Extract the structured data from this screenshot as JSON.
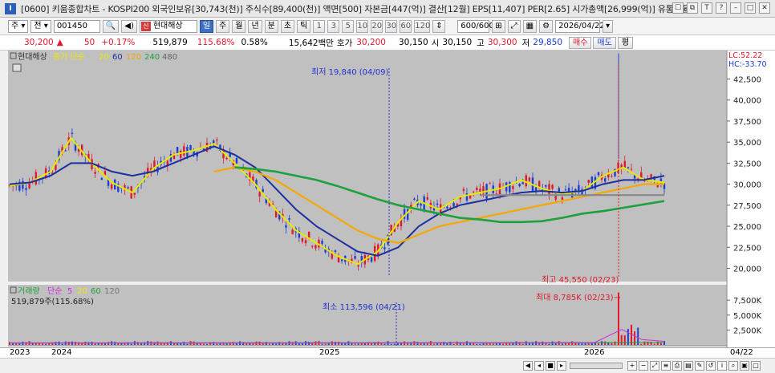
{
  "window": {
    "icon_label": "I",
    "title": "[0600] 키움종합차트 - KOSPI200 외국인보유[30,743(천)] 주식수[89,400(천)] 액면[500] 자본금[447(억)] 결산[12월] EPS[11,407] PER[2.65] 시가총액[26,999(억)] 유통비율["
  },
  "toolbar": {
    "period_select": "주",
    "market_select": "전",
    "code": "001450",
    "stock_tag": "신",
    "stock_name": "현대해상",
    "period_tabs": [
      "일",
      "주",
      "월",
      "년",
      "분",
      "초",
      "틱"
    ],
    "period_selected": "일",
    "numbers": [
      "1",
      "3",
      "5",
      "10",
      "20",
      "30",
      "60",
      "120"
    ],
    "count": "600/600",
    "date": "2026/04/22"
  },
  "quote": {
    "price": "30,200",
    "change_sign": "▲",
    "change": "50",
    "change_pct": "+0.17%",
    "volume": "519,879",
    "volume_ratio": "115.68%",
    "turnover": "0.58%",
    "trade_amount": "15,642백만",
    "bid_label": "호가",
    "bid": "30,200",
    "ask": "30,150",
    "open_label": "시",
    "open": "30,150",
    "high_label": "고",
    "high": "30,300",
    "low_label": "저",
    "low": "29,850",
    "buy_label": "매수",
    "sell_label": "매도",
    "eval_label": "평"
  },
  "chart_data": [
    {
      "type": "candlestick",
      "legend": {
        "name": "현대해상",
        "ma_label": "종가 단순",
        "periods": [
          "20",
          "60",
          "120",
          "240",
          "480"
        ],
        "colors": [
          "#e8e800",
          "#1c2ea0",
          "#f4a800",
          "#1ea03c",
          "#888888"
        ]
      },
      "y_ticks": [
        "42,500",
        "40,000",
        "37,500",
        "35,000",
        "32,500",
        "30,000",
        "27,500",
        "25,000",
        "22,500",
        "20,000"
      ],
      "ylim": [
        19000,
        45500
      ],
      "price_labels": [
        "LC:52.22",
        "HC:-33.70"
      ],
      "annotations": {
        "low": "최저 19,840 (04/09)",
        "high": "최고 45,550 (02/23)"
      },
      "series": [
        {
          "name": "20",
          "values": [
            29800,
            30200,
            31500,
            35500,
            32500,
            30200,
            29000,
            31800,
            33500,
            34000,
            34800,
            32500,
            30000,
            27000,
            24500,
            23000,
            21500,
            20500,
            22000,
            25500,
            28000,
            27000,
            28500,
            29000,
            29500,
            30500,
            29500,
            28800,
            29200,
            31000,
            32000,
            30500,
            30200
          ]
        },
        {
          "name": "60",
          "values": [
            30000,
            30200,
            31000,
            32500,
            32500,
            31500,
            31000,
            31500,
            32500,
            33500,
            34500,
            33500,
            32000,
            29500,
            27000,
            25000,
            23500,
            22000,
            21500,
            22500,
            25000,
            26500,
            27500,
            28000,
            28500,
            29000,
            29200,
            29000,
            29200,
            30000,
            30500,
            30500,
            31000
          ]
        },
        {
          "name": "120",
          "values": [
            null,
            null,
            null,
            null,
            null,
            null,
            null,
            null,
            null,
            null,
            31500,
            32000,
            31500,
            30500,
            29000,
            27500,
            26000,
            24500,
            23500,
            23000,
            24000,
            25000,
            25500,
            26000,
            26500,
            27000,
            27500,
            28000,
            28500,
            29000,
            29500,
            30000,
            30000
          ]
        },
        {
          "name": "240",
          "values": [
            null,
            null,
            null,
            null,
            null,
            null,
            null,
            null,
            null,
            null,
            null,
            32000,
            31800,
            31500,
            31000,
            30500,
            29800,
            29000,
            28200,
            27500,
            27000,
            26500,
            26000,
            25800,
            25500,
            25500,
            25600,
            26000,
            26500,
            26800,
            27200,
            27600,
            28000
          ]
        },
        {
          "name": "480",
          "values": [
            null,
            null,
            null,
            null,
            null,
            null,
            null,
            null,
            null,
            null,
            null,
            null,
            null,
            null,
            null,
            null,
            null,
            null,
            null,
            null,
            null,
            null,
            null,
            28700,
            28700,
            28700,
            28700,
            28700,
            28700,
            28700,
            28700,
            28700,
            28700
          ]
        }
      ]
    },
    {
      "type": "bar",
      "legend": {
        "name": "거래량",
        "ma_label": "단순",
        "periods": [
          "5",
          "20",
          "60",
          "120"
        ],
        "colors": [
          "#d22be0",
          "#e8e800",
          "#1ea03c",
          "#888888"
        ]
      },
      "current_volume": "519,879주(115.68%)",
      "y_ticks": [
        "7,500K",
        "5,000K",
        "2,500K"
      ],
      "ylim": [
        0,
        9000
      ],
      "annotations": {
        "low": "최소 113,596 (04/21)",
        "high": "최대 8,785K (02/23)"
      },
      "x_ticks": [
        "2023",
        "2024",
        "2025",
        "2026"
      ],
      "x_end": "04/22"
    }
  ]
}
